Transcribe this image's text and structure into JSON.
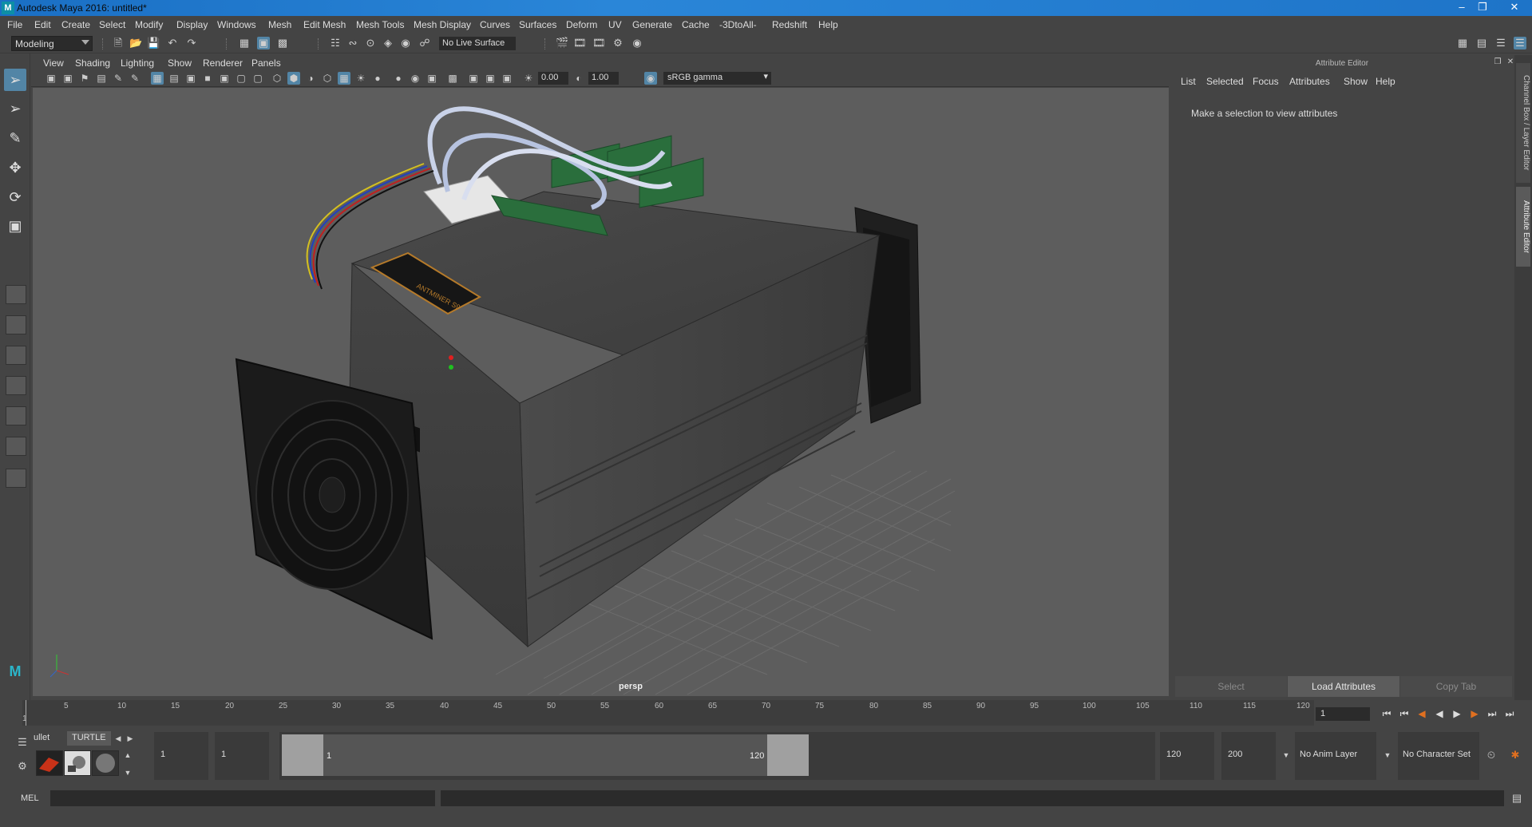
{
  "window": {
    "title": "Autodesk Maya 2016: untitled*"
  },
  "menubar": [
    "File",
    "Edit",
    "Create",
    "Select",
    "Modify",
    "Display",
    "Windows",
    "Mesh",
    "Edit Mesh",
    "Mesh Tools",
    "Mesh Display",
    "Curves",
    "Surfaces",
    "Deform",
    "UV",
    "Generate",
    "Cache",
    "-3DtoAll-",
    "Redshift",
    "Help"
  ],
  "statusline": {
    "mode": "Modeling",
    "live_surface": "No Live Surface"
  },
  "panel": {
    "menus": [
      "View",
      "Shading",
      "Lighting",
      "Show",
      "Renderer",
      "Panels"
    ],
    "exposure": "0.00",
    "gamma": "1.00",
    "color_space": "sRGB gamma",
    "camera_label": "persp"
  },
  "model": {
    "label_text": "ANTMINER S9"
  },
  "attribute_editor": {
    "title": "Attribute Editor",
    "menus": [
      "List",
      "Selected",
      "Focus",
      "Attributes",
      "Show",
      "Help"
    ],
    "message": "Make a selection to view attributes",
    "buttons": {
      "select": "Select",
      "load": "Load Attributes",
      "copy": "Copy Tab"
    },
    "side_tabs": [
      "Channel Box / Layer Editor",
      "Attribute Editor"
    ]
  },
  "timeline": {
    "ticks": [
      "5",
      "10",
      "15",
      "20",
      "25",
      "30",
      "35",
      "40",
      "45",
      "50",
      "55",
      "60",
      "65",
      "70",
      "75",
      "80",
      "85",
      "90",
      "95",
      "100",
      "105",
      "110",
      "115",
      "120"
    ],
    "first_label": "1",
    "current_frame": "1"
  },
  "shelf": {
    "tabs": [
      "ullet",
      "TURTLE"
    ]
  },
  "range": {
    "start": "1",
    "playback_start": "1",
    "slider_start": "1",
    "slider_end": "120",
    "playback_end": "120",
    "end": "200",
    "anim_layer": "No Anim Layer",
    "character_set": "No Character Set"
  },
  "commandline": {
    "label": "MEL"
  },
  "colors": {
    "accent": "#5285a6",
    "viewport_bg": "#5d5d5d",
    "panel_bg": "#444444"
  }
}
